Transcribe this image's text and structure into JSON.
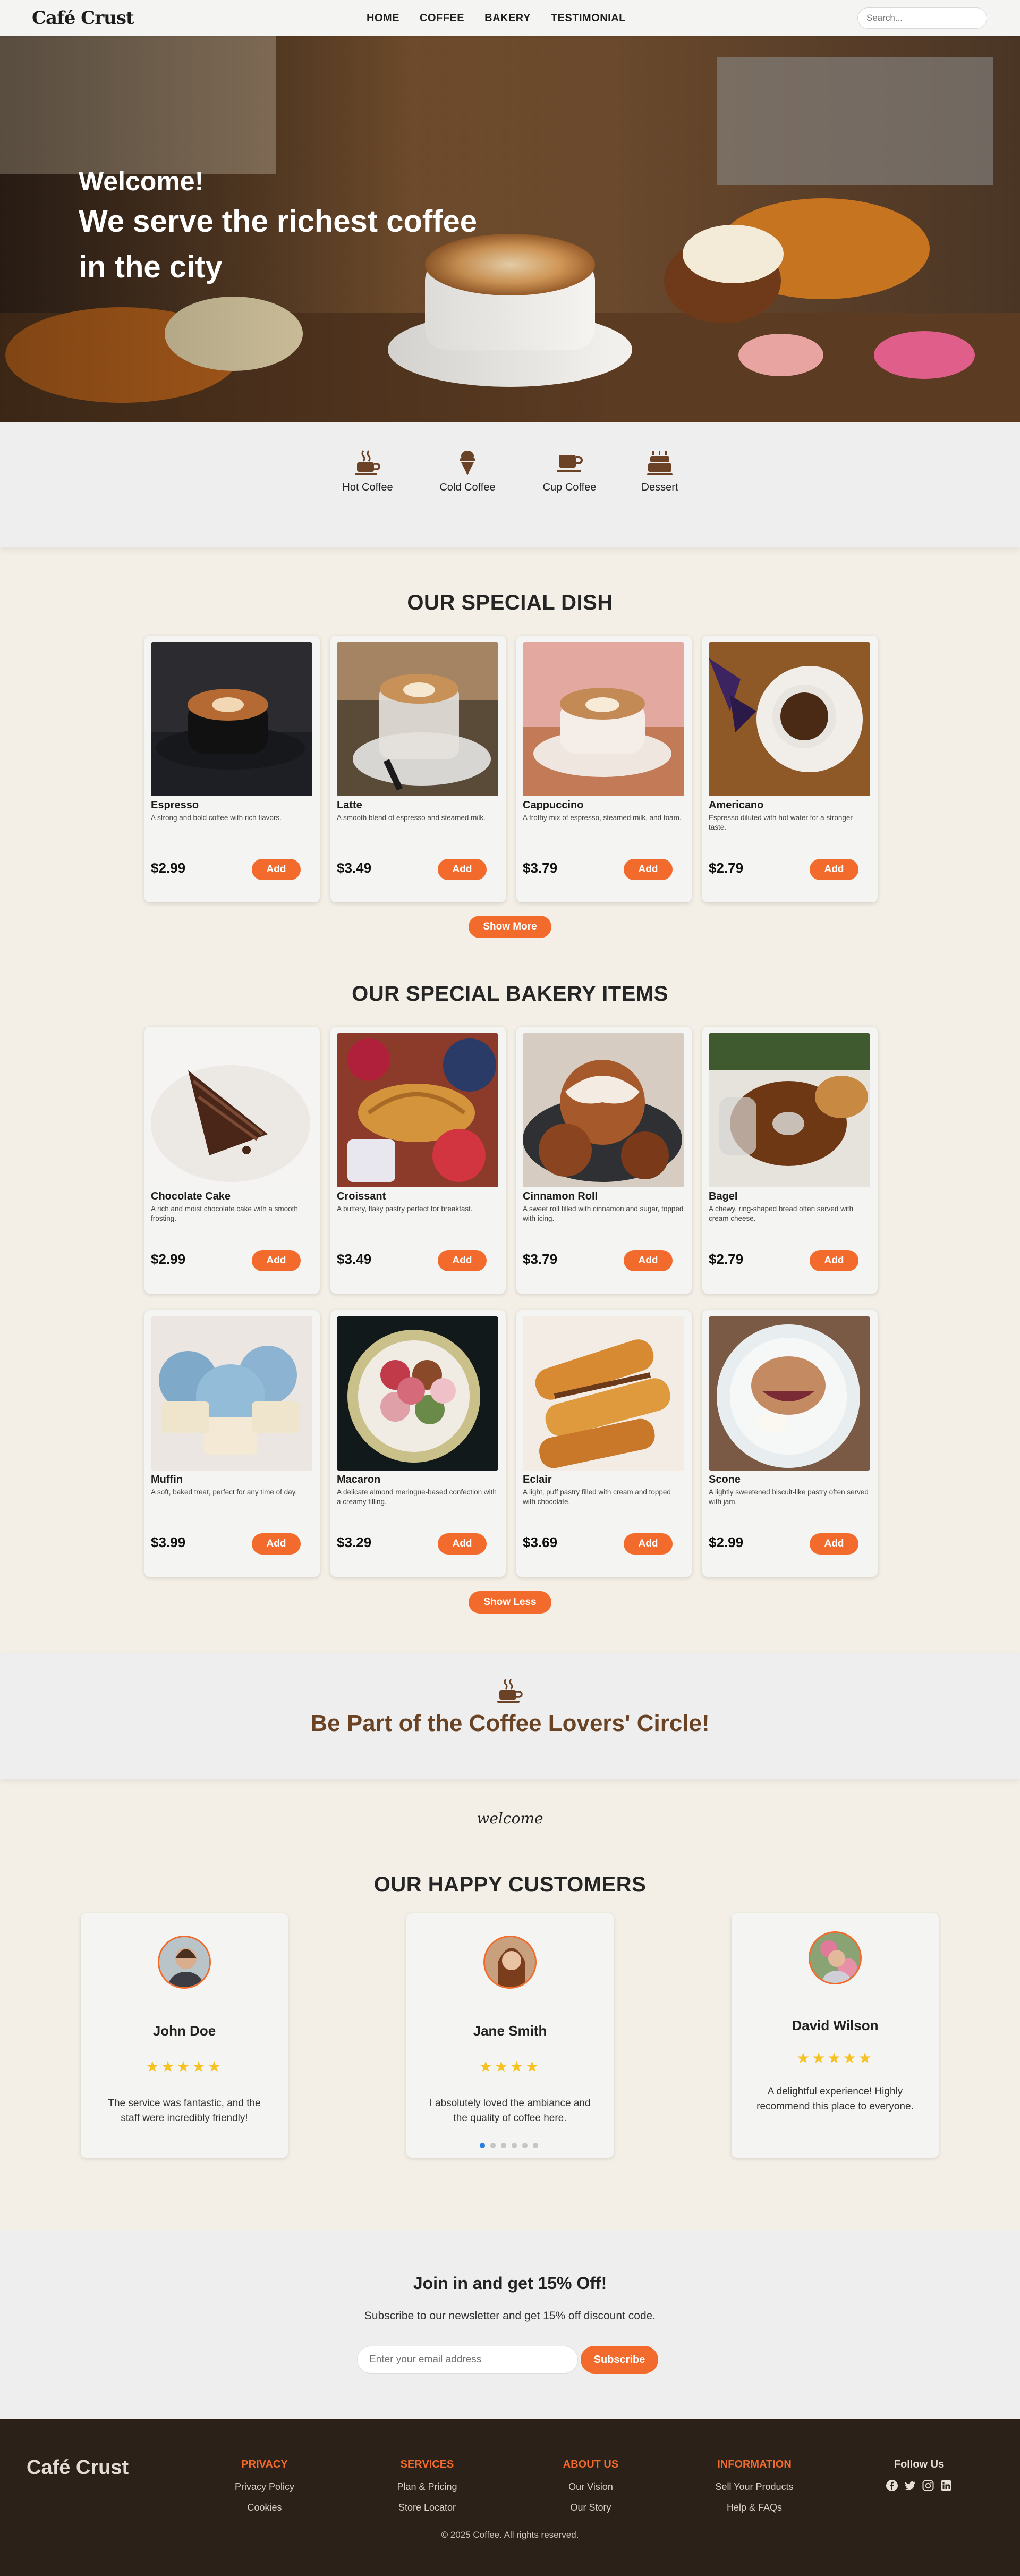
{
  "nav": {
    "brand": "Café Crust",
    "items": [
      "HOME",
      "COFFEE",
      "BAKERY",
      "TESTIMONIAL"
    ],
    "search_placeholder": "Search..."
  },
  "hero": {
    "line1": "Welcome!",
    "line2": "We serve the richest coffee",
    "line3": "in the city"
  },
  "categories": [
    {
      "label": "Hot Coffee",
      "icon": "hot-coffee-icon"
    },
    {
      "label": "Cold Coffee",
      "icon": "cold-coffee-icon"
    },
    {
      "label": "Cup Coffee",
      "icon": "cup-coffee-icon"
    },
    {
      "label": "Dessert",
      "icon": "dessert-icon"
    }
  ],
  "special": {
    "title": "OUR SPECIAL DISH",
    "items": [
      {
        "name": "Espresso",
        "desc": "A strong and bold coffee with rich flavors.",
        "price": "$2.99",
        "add": "Add"
      },
      {
        "name": "Latte",
        "desc": "A smooth blend of espresso and steamed milk.",
        "price": "$3.49",
        "add": "Add"
      },
      {
        "name": "Cappuccino",
        "desc": "A frothy mix of espresso, steamed milk, and foam.",
        "price": "$3.79",
        "add": "Add"
      },
      {
        "name": "Americano",
        "desc": "Espresso diluted with hot water for a stronger taste.",
        "price": "$2.79",
        "add": "Add"
      }
    ],
    "more": "Show More"
  },
  "bakery": {
    "title": "OUR SPECIAL BAKERY ITEMS",
    "items": [
      {
        "name": "Chocolate Cake",
        "desc": "A rich and moist chocolate cake with a smooth frosting.",
        "price": "$2.99",
        "add": "Add"
      },
      {
        "name": "Croissant",
        "desc": "A buttery, flaky pastry perfect for breakfast.",
        "price": "$3.49",
        "add": "Add"
      },
      {
        "name": "Cinnamon Roll",
        "desc": "A sweet roll filled with cinnamon and sugar, topped with icing.",
        "price": "$3.79",
        "add": "Add"
      },
      {
        "name": "Bagel",
        "desc": "A chewy, ring-shaped bread often served with cream cheese.",
        "price": "$2.79",
        "add": "Add"
      },
      {
        "name": "Muffin",
        "desc": "A soft, baked treat, perfect for any time of day.",
        "price": "$3.99",
        "add": "Add"
      },
      {
        "name": "Macaron",
        "desc": "A delicate almond meringue-based confection with a creamy filling.",
        "price": "$3.29",
        "add": "Add"
      },
      {
        "name": "Eclair",
        "desc": "A light, puff pastry filled with cream and topped with chocolate.",
        "price": "$3.69",
        "add": "Add"
      },
      {
        "name": "Scone",
        "desc": "A lightly sweetened biscuit-like pastry often served with jam.",
        "price": "$2.99",
        "add": "Add"
      }
    ],
    "less": "Show Less"
  },
  "circle": {
    "title": "Be Part of the Coffee Lovers' Circle!"
  },
  "welcome_script": "welcome",
  "testimonials": {
    "title": "OUR HAPPY CUSTOMERS",
    "items": [
      {
        "name": "John Doe",
        "stars": "★★★★★",
        "quote": "The service was fantastic, and the staff were incredibly friendly!"
      },
      {
        "name": "Jane Smith",
        "stars": "★★★★",
        "quote": "I absolutely loved the ambiance and the quality of coffee here."
      },
      {
        "name": "David Wilson",
        "stars": "★★★★★",
        "quote": "A delightful experience! Highly recommend this place to everyone."
      }
    ],
    "rating_values": [
      5,
      4,
      5
    ]
  },
  "newsletter": {
    "title": "Join in and get 15% Off!",
    "subtitle": "Subscribe to our newsletter and get 15% off discount code.",
    "placeholder": "Enter your email address",
    "button": "Subscribe"
  },
  "footer": {
    "brand": "Café Crust",
    "columns": [
      {
        "heading": "PRIVACY",
        "links": [
          "Privacy Policy",
          "Cookies"
        ]
      },
      {
        "heading": "SERVICES",
        "links": [
          "Plan & Pricing",
          "Store Locator"
        ]
      },
      {
        "heading": "ABOUT US",
        "links": [
          "Our Vision",
          "Our Story"
        ]
      },
      {
        "heading": "INFORMATION",
        "links": [
          "Sell Your Products",
          "Help & FAQs"
        ]
      }
    ],
    "follow": "Follow Us",
    "social": [
      "facebook-icon",
      "twitter-icon",
      "instagram-icon",
      "linkedin-icon"
    ],
    "copyright": "© 2025 Coffee. All rights reserved."
  },
  "colors": {
    "accent": "#f26b2c",
    "footer_bg": "#2b2119",
    "page_bg": "#f3efe6",
    "heading_brown": "#6a4325"
  }
}
